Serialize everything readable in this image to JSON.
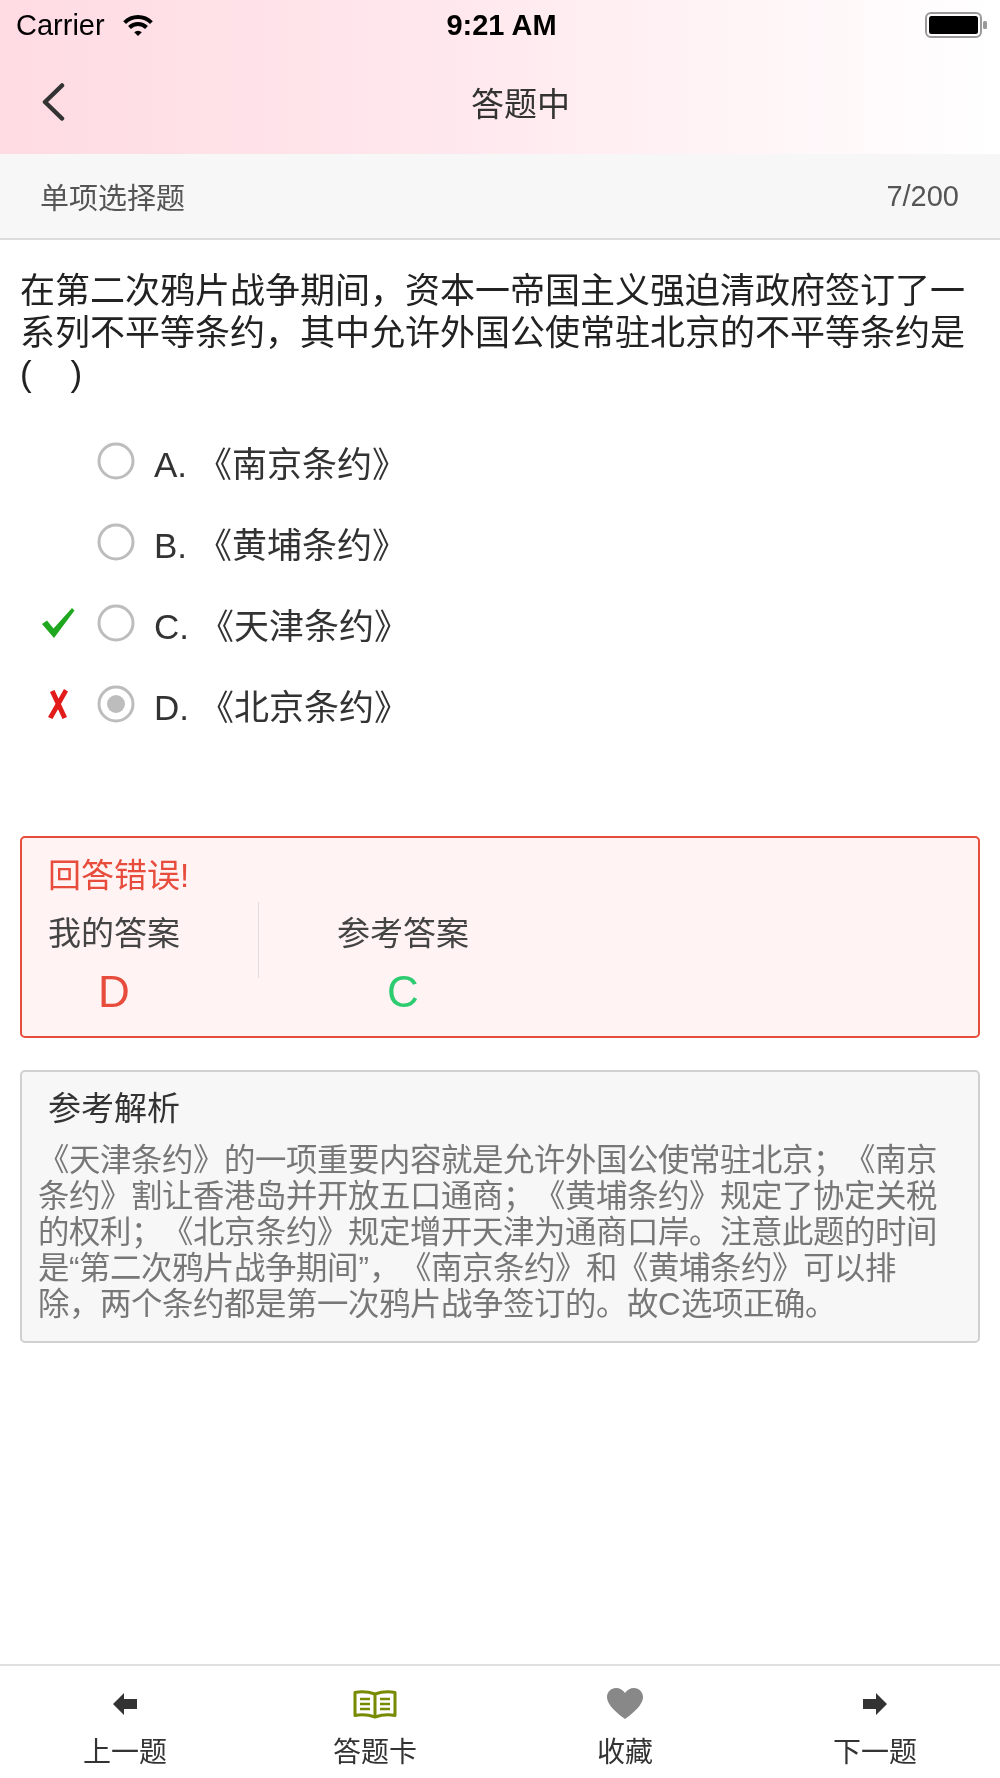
{
  "status_bar": {
    "carrier": "Carrier",
    "time": "9:21 AM"
  },
  "nav_bar": {
    "title": "答题中"
  },
  "question_header": {
    "type": "单项选择题",
    "progress": "7/200"
  },
  "question": {
    "text": "在第二次鸦片战争期间，资本一帝国主义强迫清政府签订了一系列不平等条约，其中允许外国公使常驻北京的不平等条约是(    )",
    "options": [
      {
        "label": "A. 《南京条约》",
        "selected": false,
        "correct": false
      },
      {
        "label": "B. 《黄埔条约》",
        "selected": false,
        "correct": false
      },
      {
        "label": "C. 《天津条约》",
        "selected": false,
        "correct": true
      },
      {
        "label": "D. 《北京条约》",
        "selected": true,
        "correct": false
      }
    ]
  },
  "result": {
    "correct": false,
    "verdict": "回答错误!",
    "my_answer": {
      "label": "我的答案",
      "value": "D"
    },
    "reference_answer": {
      "label": "参考答案",
      "value": "C"
    }
  },
  "explanation": {
    "title": "参考解析",
    "text": "《天津条约》的一项重要内容就是允许外国公使常驻北京；《南京条约》割让香港岛并开放五口通商；《黄埔条约》规定了协定关税的权利；《北京条约》规定增开天津为通商口岸。注意此题的时间是“第二次鸦片战争期间”，《南京条约》和《黄埔条约》可以排除，两个条约都是第一次鸦片战争签订的。故C选项正确。"
  },
  "tab_bar": {
    "items": [
      {
        "kind": "prev",
        "label": "上一题"
      },
      {
        "kind": "card",
        "label": "答题卡"
      },
      {
        "kind": "favorite",
        "label": "收藏"
      },
      {
        "kind": "next",
        "label": "下一题"
      }
    ]
  }
}
